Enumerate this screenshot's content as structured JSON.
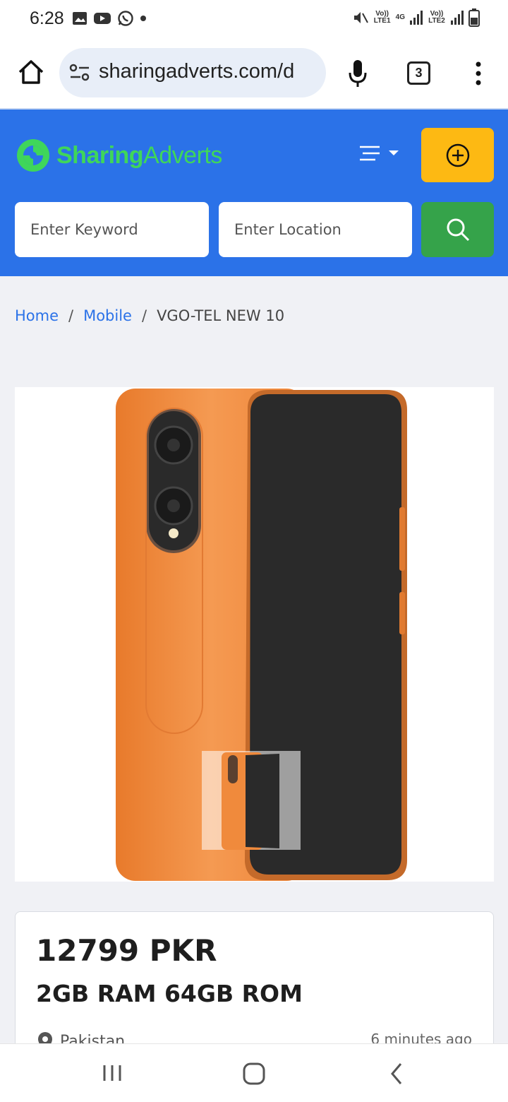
{
  "status_bar": {
    "time": "6:28",
    "sim1": "Vo)) LTE1",
    "sim2": "Vo)) LTE2",
    "net": "4G"
  },
  "browser": {
    "url": "sharingadverts.com/d",
    "tab_count": "3"
  },
  "site": {
    "logo_part1": "Sharing",
    "logo_part2": "Adverts",
    "keyword_placeholder": "Enter Keyword",
    "location_placeholder": "Enter Location"
  },
  "breadcrumb": {
    "home": "Home",
    "category": "Mobile",
    "current": "VGO-TEL NEW 10",
    "sep": "/"
  },
  "listing": {
    "price": "12799 PKR",
    "title": "2GB RAM 64GB ROM",
    "location": "Pakistan",
    "time_ago": "6 minutes ago"
  },
  "colors": {
    "header_blue": "#2b72e8",
    "add_yellow": "#fdb913",
    "search_green": "#35a34a",
    "phone_orange": "#f08a3c"
  }
}
